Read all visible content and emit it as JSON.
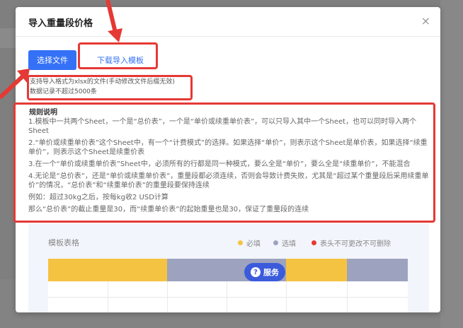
{
  "modal": {
    "title": "导入重量段价格",
    "close_icon": "×"
  },
  "actions": {
    "select_file_label": "选择文件",
    "download_template_label": "下载导入模板"
  },
  "hint": {
    "line1": "支持导入格式为xlsx的文件(手动修改文件后缀无效)",
    "line2": "数据记录不超过5000条"
  },
  "rules": {
    "title": "规则说明",
    "items": [
      "1.模板中一共两个Sheet，一个是“总价表”，一个是“单价或续重单价表”，可以只导入其中一个Sheet，也可以同时导入两个Sheet",
      "2.“单价或续重单价表”这个Sheet中，有一个“计费模式”的选择。如果选择“单价”，则表示这个Sheet是单价表，如果选择“续重单价”，则表示这个Sheet是续重价表",
      "3.在一个“单价或续重单价表”Sheet中，必须所有的行都是同一种模式，要么全是“单价”，要么全是“续重单价”，不能混合",
      "4.无论是“总价表”，还是“单价或续重单价表”，重量段都必须连续，否则会导致计费失败，尤其是“超过某个重量段后采用续重单价”的情况，“总价表”和“续重单价表”的重量段要保持连续",
      "例如：超过30kg之后，按每kg收2 USD计算",
      "那么“总价表”的截止重量是30，而“续重单价表”的起始重量也是30，保证了重量段的连续"
    ]
  },
  "template": {
    "title": "模板表格",
    "legend": {
      "required": "必填",
      "optional": "选填",
      "locked": "表头不可更改不可删除"
    },
    "colors": {
      "required": "#f5c342",
      "optional": "#9da3bf",
      "locked": "#e53935"
    }
  },
  "service_button": {
    "label": "服务",
    "icon": "?"
  },
  "colors": {
    "accent": "#3471f7",
    "annotation": "#e53935"
  }
}
